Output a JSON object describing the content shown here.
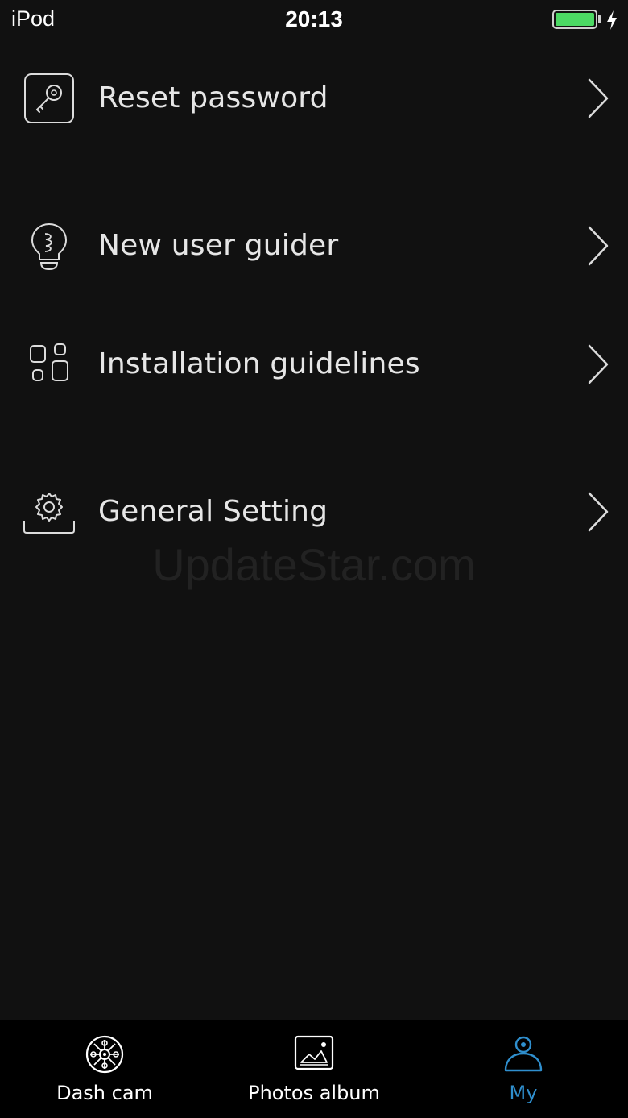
{
  "status_bar": {
    "device": "iPod",
    "time": "20:13",
    "battery_level": 1.0,
    "charging": true,
    "battery_color": "#4cd964"
  },
  "menu": {
    "items": [
      {
        "label": "Reset password",
        "icon": "key-icon"
      },
      {
        "label": "New user guider",
        "icon": "lightbulb-icon"
      },
      {
        "label": "Installation guidelines",
        "icon": "grid-icon"
      },
      {
        "label": "General Setting",
        "icon": "gear-icon"
      }
    ]
  },
  "watermark": "UpdateStar.com",
  "tab_bar": {
    "tabs": [
      {
        "label": "Dash cam",
        "icon": "camera-aperture-icon",
        "active": false
      },
      {
        "label": "Photos album",
        "icon": "photo-icon",
        "active": false
      },
      {
        "label": "My",
        "icon": "user-icon",
        "active": true
      }
    ],
    "active_color": "#2f8fce"
  }
}
